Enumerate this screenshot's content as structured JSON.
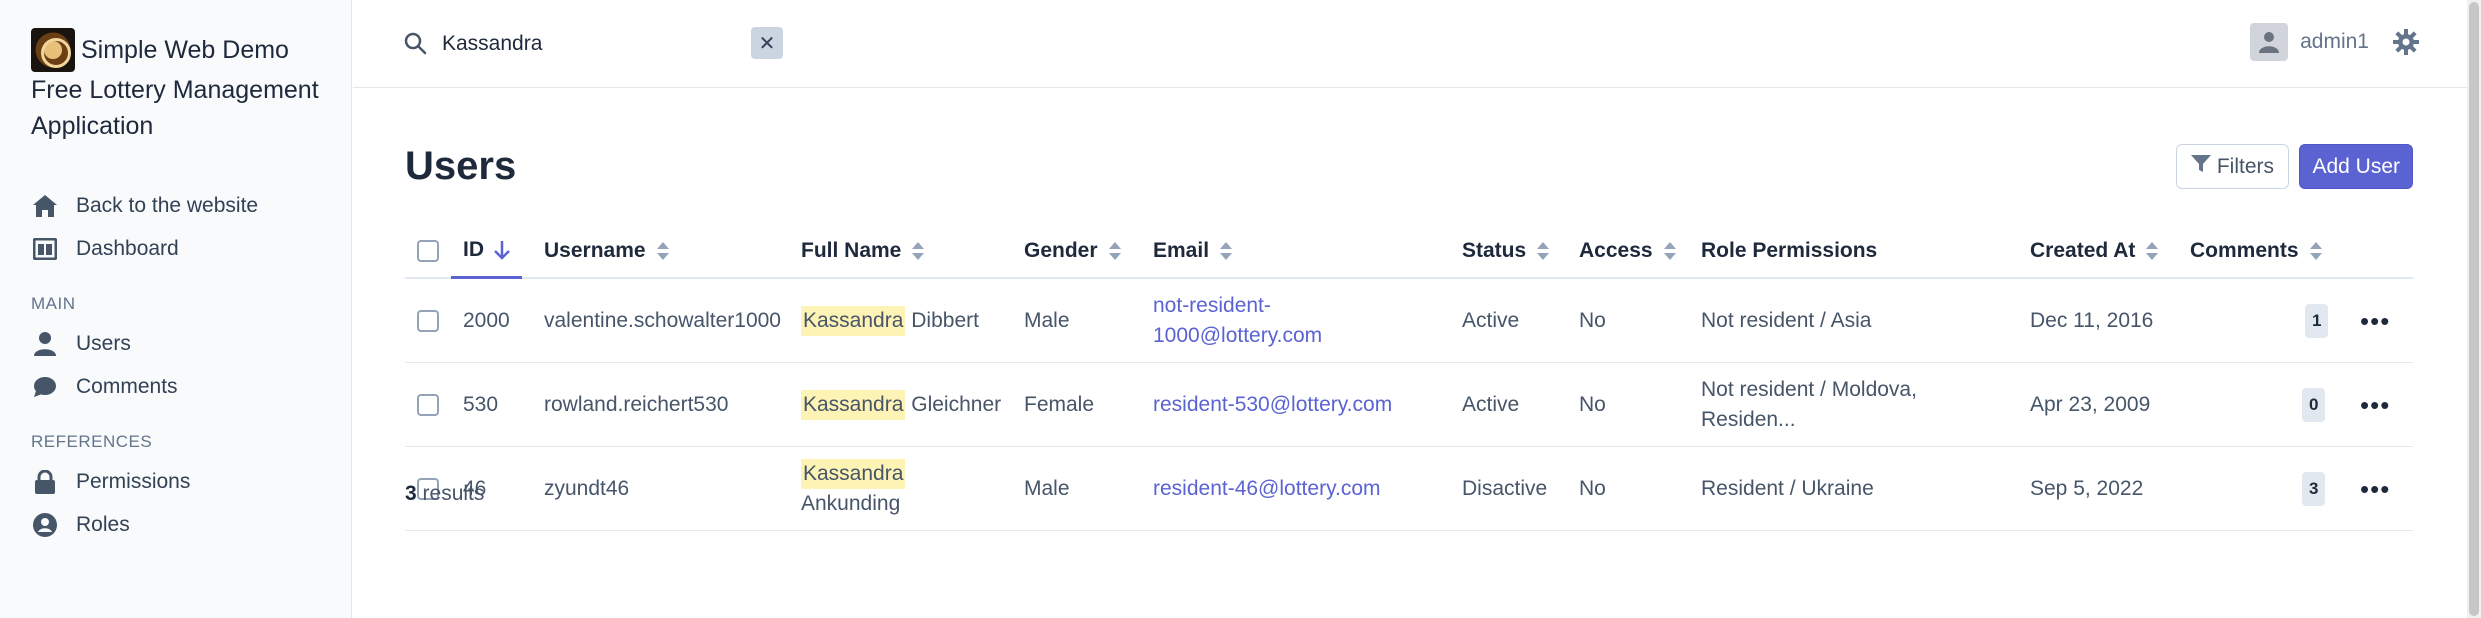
{
  "sidebar": {
    "title_line1": "Simple Web Demo",
    "title_line2": "Free Lottery Management",
    "title_line3": "Application",
    "items_top": [
      {
        "label": "Back to the website",
        "icon": "home-icon"
      },
      {
        "label": "Dashboard",
        "icon": "dashboard-icon"
      }
    ],
    "section_main": "MAIN",
    "items_main": [
      {
        "label": "Users",
        "icon": "user-icon"
      },
      {
        "label": "Comments",
        "icon": "comment-icon"
      }
    ],
    "section_references": "REFERENCES",
    "items_references": [
      {
        "label": "Permissions",
        "icon": "lock-icon"
      },
      {
        "label": "Roles",
        "icon": "user-circle-icon"
      }
    ]
  },
  "topbar": {
    "search_value": "Kassandra",
    "clear_label": "✕",
    "username": "admin1"
  },
  "page": {
    "title": "Users",
    "filters_label": "Filters",
    "add_label": "Add User",
    "results_count": "3",
    "results_label": "results"
  },
  "table": {
    "columns": {
      "id": "ID",
      "username": "Username",
      "fullname": "Full Name",
      "gender": "Gender",
      "email": "Email",
      "status": "Status",
      "access": "Access",
      "role": "Role Permissions",
      "created": "Created At",
      "comments": "Comments"
    },
    "rows": [
      {
        "id": "2000",
        "username": "valentine.schowalter1000",
        "first": "Kassandra",
        "last": "Dibbert",
        "gender": "Male",
        "email_l1": "not-resident-",
        "email_l2": "1000@lottery.com",
        "status": "Active",
        "access": "No",
        "role_l1": "Not resident / Asia",
        "role_l2": "",
        "created": "Dec 11, 2016",
        "comments": "1"
      },
      {
        "id": "530",
        "username": "rowland.reichert530",
        "first": "Kassandra",
        "last": "Gleichner",
        "gender": "Female",
        "email_l1": "resident-530@lottery.com",
        "email_l2": "",
        "status": "Active",
        "access": "No",
        "role_l1": "Not resident / Moldova,",
        "role_l2": "Residen...",
        "created": "Apr 23, 2009",
        "comments": "0"
      },
      {
        "id": "46",
        "username": "zyundt46",
        "first": "Kassandra",
        "last": "Ankunding",
        "gender": "Male",
        "email_l1": "resident-46@lottery.com",
        "email_l2": "",
        "status": "Disactive",
        "access": "No",
        "role_l1": "Resident / Ukraine",
        "role_l2": "",
        "created": "Sep 5, 2022",
        "comments": "3"
      }
    ]
  },
  "colors": {
    "accent": "#5b63d3",
    "highlight": "#fdf3b4",
    "sidebar_bg": "#f8fafc"
  }
}
